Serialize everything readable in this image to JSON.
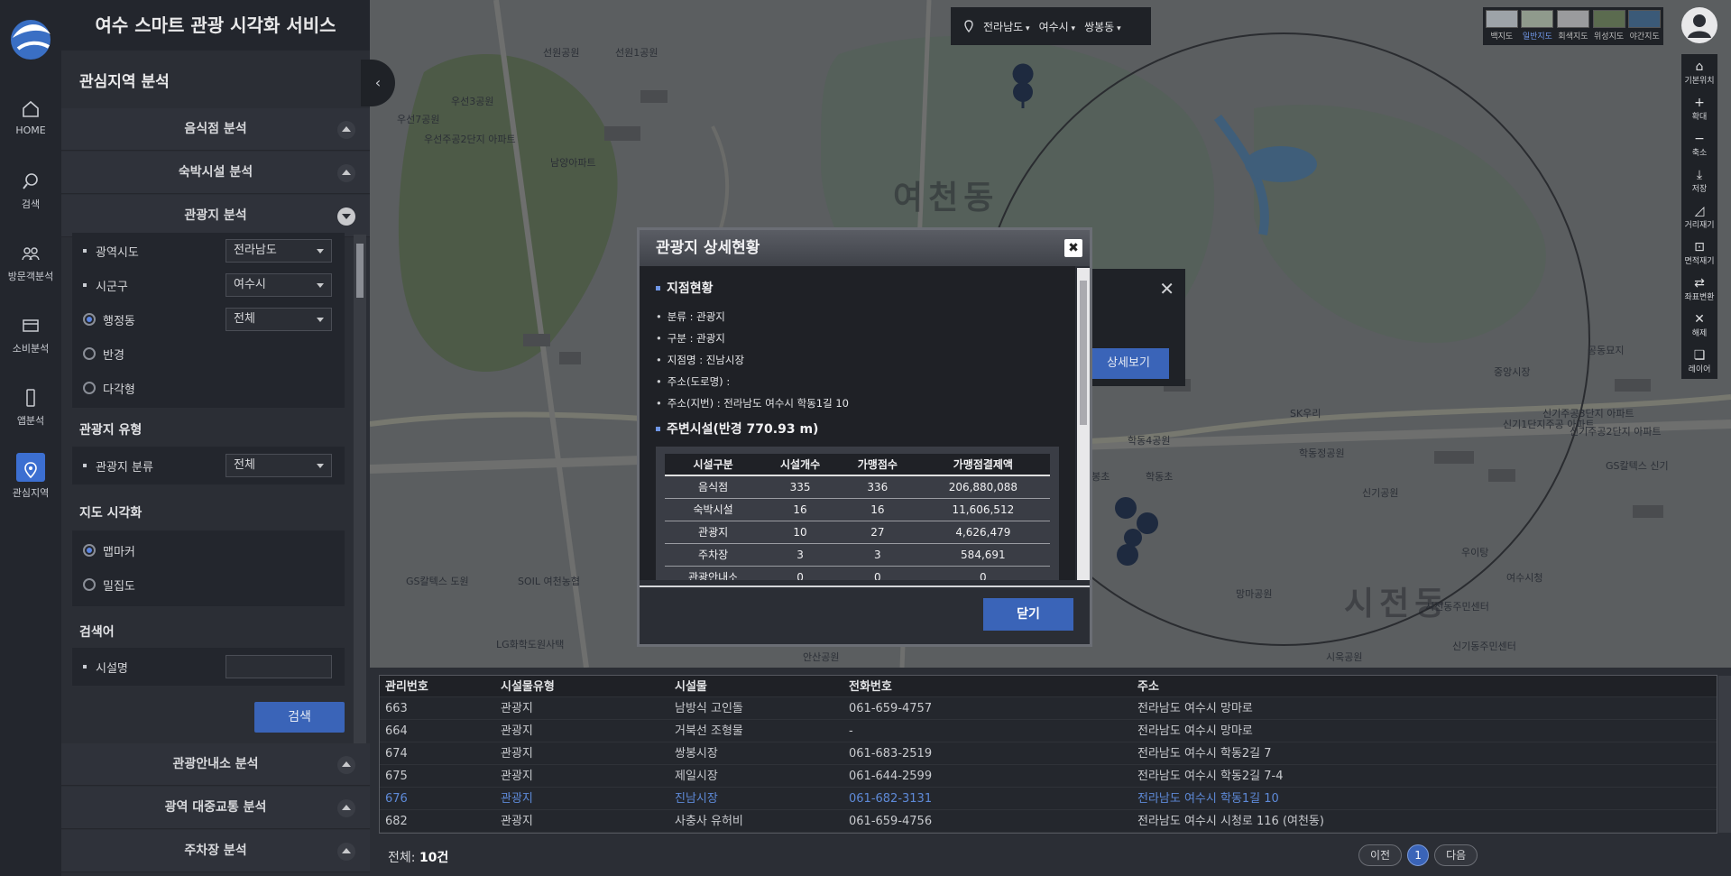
{
  "app": {
    "title": "여수 스마트 관광 시각화 서비스"
  },
  "rail": [
    {
      "label": "HOME",
      "icon": "home-icon"
    },
    {
      "label": "검색",
      "icon": "search-icon"
    },
    {
      "label": "방문객분석",
      "icon": "users-icon"
    },
    {
      "label": "소비분석",
      "icon": "card-icon"
    },
    {
      "label": "앱분석",
      "icon": "phone-icon"
    },
    {
      "label": "관심지역",
      "icon": "location-pin-icon",
      "active": true
    }
  ],
  "panel": {
    "title": "관심지역 분석",
    "sections": {
      "restaurant": "음식점 분석",
      "lodging": "숙박시설 분석",
      "tourism": "관광지 분석",
      "info_center": "관광안내소 분석",
      "transit": "광역 대중교통 분석",
      "parking": "주차장 분석"
    },
    "region": {
      "province_label": "광역시도",
      "province_value": "전라남도",
      "city_label": "시군구",
      "city_value": "여수시",
      "dong_label": "행정동",
      "dong_value": "전체",
      "radius_label": "반경",
      "polygon_label": "다각형"
    },
    "type_title": "관광지 유형",
    "type_label": "관광지 분류",
    "type_value": "전체",
    "viz_title": "지도 시각화",
    "viz_marker": "맵마커",
    "viz_density": "밀집도",
    "keyword_title": "검색어",
    "keyword_label": "시설명",
    "keyword_placeholder": "",
    "search_button": "검색"
  },
  "map": {
    "location": {
      "province": "전라남도",
      "city": "여수시",
      "dong": "쌍봉동"
    },
    "map_types": [
      "백지도",
      "일반지도",
      "회색지도",
      "위성지도",
      "야간지도"
    ],
    "active_map_type": "일반지도",
    "tools": [
      {
        "label": "기본위치",
        "icon": "home-icon"
      },
      {
        "label": "확대",
        "icon": "plus-icon"
      },
      {
        "label": "축소",
        "icon": "minus-icon"
      },
      {
        "label": "저장",
        "icon": "download-icon"
      },
      {
        "label": "거리재기",
        "icon": "ruler-icon"
      },
      {
        "label": "면적재기",
        "icon": "area-icon"
      },
      {
        "label": "좌표변환",
        "icon": "swap-icon"
      },
      {
        "label": "해제",
        "icon": "close-icon"
      },
      {
        "label": "레이어",
        "icon": "layers-icon"
      }
    ],
    "labels": [
      "여천동",
      "시전동",
      "선원공원",
      "선원1공원",
      "우선3공원",
      "우선7공원",
      "우선주공2단지 아파트",
      "남양아파트",
      "GS칼텍스 도원",
      "SOIL 여천농협",
      "학동4공원",
      "학동초",
      "쌍봉초",
      "SK우리",
      "학동정공원",
      "신기공원",
      "신기주공3단지 아파트",
      "망마공원",
      "시전동주민센터",
      "여수시청",
      "안산공원",
      "LG화학도원사택",
      "중앙시장",
      "GS칼텍스 신기",
      "공동묘지",
      "우이탕",
      "신기1단지주공 아파트",
      "신기주공2단지 아파트",
      "신기동주민센터",
      "시욱공원"
    ],
    "popup_button": "상세보기"
  },
  "modal": {
    "title": "관광지 상세현황",
    "branch_title": "지점현황",
    "items": [
      "분류 : 관광지",
      "구분 : 관광지",
      "지점명 : 진남시장",
      "주소(도로명) :",
      "주소(지번) : 전라남도 여수시 학동1길 10"
    ],
    "nearby_title": "주변시설(반경 770.93 m)",
    "table_headers": [
      "시설구분",
      "시설개수",
      "가맹점수",
      "가맹점결제액"
    ],
    "table_rows": [
      [
        "음식점",
        "335",
        "336",
        "206,880,088"
      ],
      [
        "숙박시설",
        "16",
        "16",
        "11,606,512"
      ],
      [
        "관광지",
        "10",
        "27",
        "4,626,479"
      ],
      [
        "주차장",
        "3",
        "3",
        "584,691"
      ],
      [
        "관광안내소",
        "0",
        "0",
        "0"
      ]
    ],
    "close_button": "닫기"
  },
  "results": {
    "headers": [
      "관리번호",
      "시설물유형",
      "시설물",
      "전화번호",
      "주소"
    ],
    "rows": [
      [
        "663",
        "관광지",
        "남방식 고인돌",
        "061-659-4757",
        "전라남도 여수시 망마로"
      ],
      [
        "664",
        "관광지",
        "거북선 조형물",
        "-",
        "전라남도 여수시 망마로"
      ],
      [
        "674",
        "관광지",
        "쌍봉시장",
        "061-683-2519",
        "전라남도 여수시 학동2길 7"
      ],
      [
        "675",
        "관광지",
        "제일시장",
        "061-644-2599",
        "전라남도 여수시 학동2길 7-4"
      ],
      [
        "676",
        "관광지",
        "진남시장",
        "061-682-3131",
        "전라남도 여수시 학동1길 10"
      ],
      [
        "682",
        "관광지",
        "사충사 유허비",
        "061-659-4756",
        "전라남도 여수시 시청로 116 (여천동)"
      ]
    ],
    "selected_row": 4,
    "total": "전체: ",
    "total_count": "10건",
    "pager": {
      "prev": "이전",
      "page": "1",
      "next": "다음"
    }
  }
}
